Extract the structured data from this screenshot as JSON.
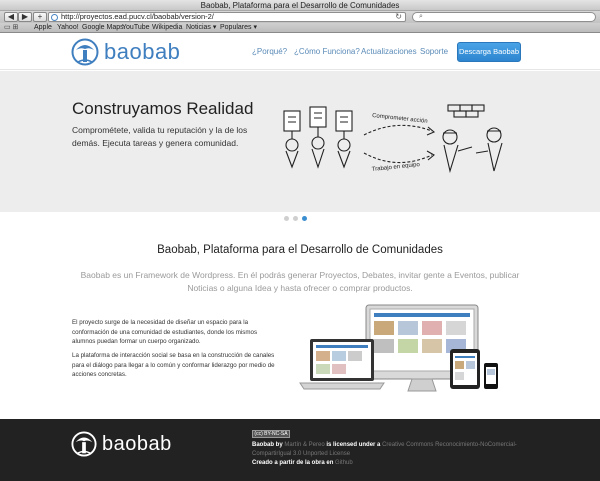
{
  "window": {
    "title": "Baobab, Plataforma para el Desarrollo de Comunidades"
  },
  "browser": {
    "url": "http://proyectos.ead.pucv.cl/baobab/version-2/",
    "back_icon": "back-arrow-icon",
    "forward_icon": "forward-arrow-icon",
    "add_icon": "plus-icon",
    "reload_icon": "reload-icon",
    "search_icon": "search-icon",
    "bookmarks": [
      "Apple",
      "Yahoo!",
      "Google Maps",
      "YouTube",
      "Wikipedia",
      "Noticias ▾",
      "Populares ▾"
    ]
  },
  "header": {
    "logo_text": "baobab",
    "nav": [
      "¿Porqué?",
      "¿Cómo Funciona?",
      "Actualizaciones",
      "Soporte"
    ],
    "download_label": "Descarga Baobab"
  },
  "hero": {
    "title": "Construyamos Realidad",
    "subtitle": "Comprométete, valida tu reputación y la de los demás. Ejecuta tareas y genera comunidad.",
    "illustration_labels": [
      "Comprometer acción",
      "Trabajo en equipo"
    ],
    "slides": 3,
    "active_slide": 3
  },
  "main": {
    "title": "Baobab, Plataforma para el Desarrollo de Comunidades",
    "lead": "Baobab es un Framework de Wordpress. En él podrás generar Proyectos, Debates, invitar gente a Eventos, publicar Noticias o alguna Idea y hasta ofrecer o comprar productos.",
    "paragraph_1": "El proyecto surge de la necesidad de diseñar un espacio para la conformación de una comunidad de estudiantes, donde los mismos alumnos puedan formar un cuerpo organizado.",
    "paragraph_2": "La plataforma de interacción social se basa en la construcción de canales para el diálogo para llegar a lo común y conformar liderazgo por medio de acciones concretas."
  },
  "footer": {
    "logo_text": "baobab",
    "cc_badge": "(cc) BY-NC-SA",
    "line1_a": "Baobab by",
    "line1_author": "Martín & Pereo",
    "line1_b": "is licensed under a",
    "line1_license": "Creative Commons Reconocimiento-NoComercial-CompartirIgual 3.0 Unported License",
    "line2_a": "Creado a partir de la obra en",
    "line2_link": "Github"
  },
  "colors": {
    "brand_blue": "#3f7fbf",
    "button_blue": "#2d85cf",
    "footer_bg": "#222222",
    "hero_bg": "#ededed"
  }
}
